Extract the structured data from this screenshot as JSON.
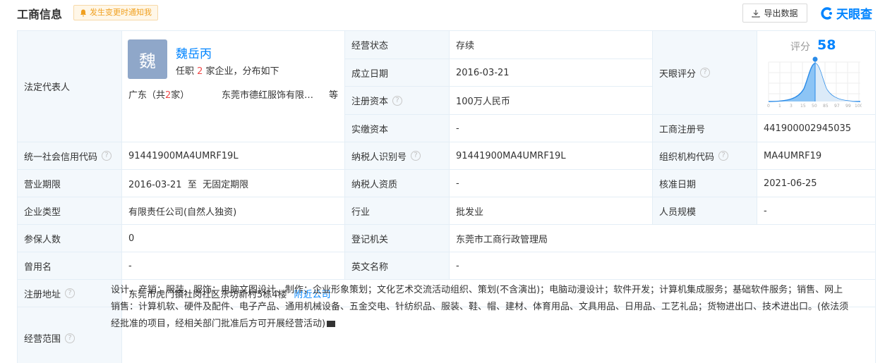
{
  "header": {
    "title": "工商信息",
    "notify_label": "发生变更时通知我",
    "export_label": "导出数据",
    "brand": "天眼查"
  },
  "rep": {
    "label": "法定代表人",
    "avatar_char": "魏",
    "name": "魏岳丙",
    "sub_prefix": "任职 ",
    "sub_count": "2",
    "sub_suffix": " 家企业，分布如下",
    "region_prefix": "广东（共",
    "region_count": "2",
    "region_suffix": "家）",
    "company": "东莞市德红服饰有限…",
    "more": "等"
  },
  "score": {
    "label": "天眼评分",
    "word": "评分",
    "value": "58",
    "ticks": [
      "0",
      "1",
      "3",
      "15",
      "50",
      "85",
      "97",
      "99",
      "100"
    ]
  },
  "fields": {
    "status_label": "经营状态",
    "status_value": "存续",
    "founded_label": "成立日期",
    "founded_value": "2016-03-21",
    "capital_label": "注册资本",
    "capital_value": "100万人民币",
    "paid_label": "实缴资本",
    "paid_value": "-",
    "regno_label": "工商注册号",
    "regno_value": "441900002945035",
    "credit_label": "统一社会信用代码",
    "credit_value": "91441900MA4UMRF19L",
    "taxid_label": "纳税人识别号",
    "taxid_value": "91441900MA4UMRF19L",
    "orgcode_label": "组织机构代码",
    "orgcode_value": "MA4UMRF19",
    "term_label": "营业期限",
    "term_value": "2016-03-21  至  无固定期限",
    "taxq_label": "纳税人资质",
    "taxq_value": "-",
    "approve_label": "核准日期",
    "approve_value": "2021-06-25",
    "type_label": "企业类型",
    "type_value": "有限责任公司(自然人独资)",
    "industry_label": "行业",
    "industry_value": "批发业",
    "staff_label": "人员规模",
    "staff_value": "-",
    "insured_label": "参保人数",
    "insured_value": "0",
    "authority_label": "登记机关",
    "authority_value": "东莞市工商行政管理局",
    "former_label": "曾用名",
    "former_value": "-",
    "english_label": "英文名称",
    "english_value": "-",
    "address_label": "注册地址",
    "address_value": "东莞市虎门镇社岗社区东坊新村5栋4楼",
    "nearby_label": "附近公司",
    "scope_label": "经营范围",
    "scope_value": "设计、产销：服装、服饰；电脑文图设计、制作；企业形象策划；文化艺术交流活动组织、策划(不含演出)；电脑动漫设计；软件开发；计算机集成服务；基础软件服务；销售、网上销售：计算机软、硬件及配件、电子产品、通用机械设备、五金交电、针纺织品、服装、鞋、帽、建材、体育用品、文具用品、日用品、工艺礼品；货物进出口、技术进出口。(依法须经批准的项目，经相关部门批准后方可开展经营活动)"
  }
}
